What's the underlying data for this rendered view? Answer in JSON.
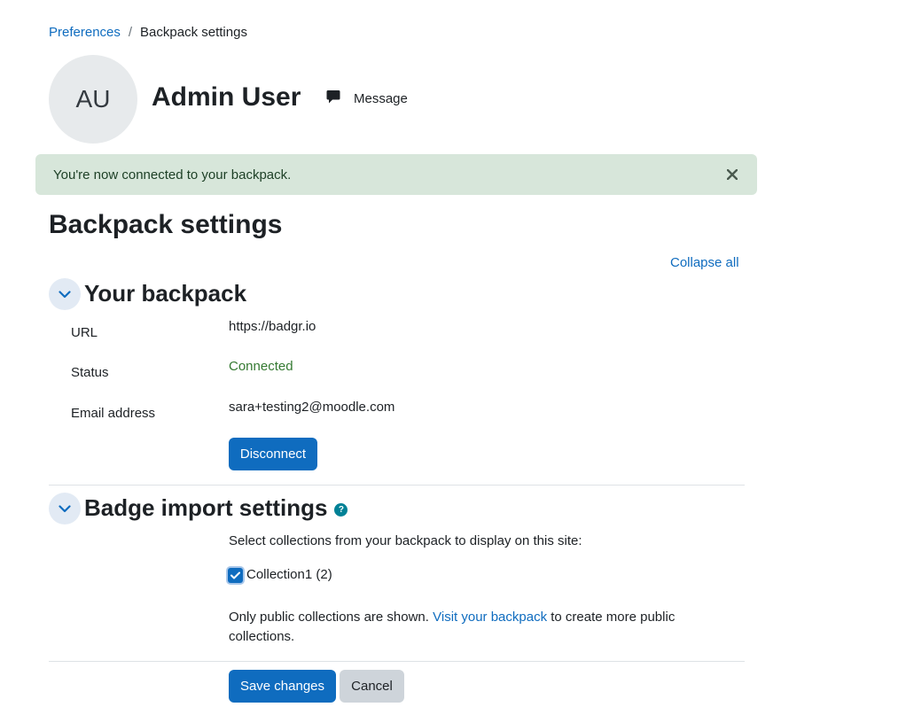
{
  "breadcrumb": {
    "parent": "Preferences",
    "separator": "/",
    "current": "Backpack settings"
  },
  "user": {
    "initials": "AU",
    "name": "Admin User",
    "message_label": "Message"
  },
  "alert": {
    "text": "You're now connected to your backpack."
  },
  "page": {
    "title": "Backpack settings",
    "collapse_all": "Collapse all"
  },
  "your_backpack": {
    "title": "Your backpack",
    "url_label": "URL",
    "url_value": "https://badgr.io",
    "status_label": "Status",
    "status_value": "Connected",
    "email_label": "Email address",
    "email_value": "sara+testing2@moodle.com",
    "disconnect_label": "Disconnect"
  },
  "badge_import": {
    "title": "Badge import settings",
    "help_symbol": "?",
    "instructions": "Select collections from your backpack to display on this site:",
    "collections": [
      {
        "label": "Collection1 (2)",
        "checked": true
      }
    ],
    "note_prefix": "Only public collections are shown. ",
    "note_link": "Visit your backpack",
    "note_suffix": " to create more public collections."
  },
  "actions": {
    "save_label": "Save changes",
    "cancel_label": "Cancel"
  },
  "colors": {
    "primary": "#0f6cbf",
    "success_text": "#357a32",
    "alert_bg": "#d7e6da",
    "help_icon": "#008196"
  },
  "icons": {
    "message": "message-bubble-icon",
    "close": "close-icon",
    "chevron": "chevron-down-icon",
    "help": "question-circle-icon",
    "check": "checkmark-icon"
  }
}
